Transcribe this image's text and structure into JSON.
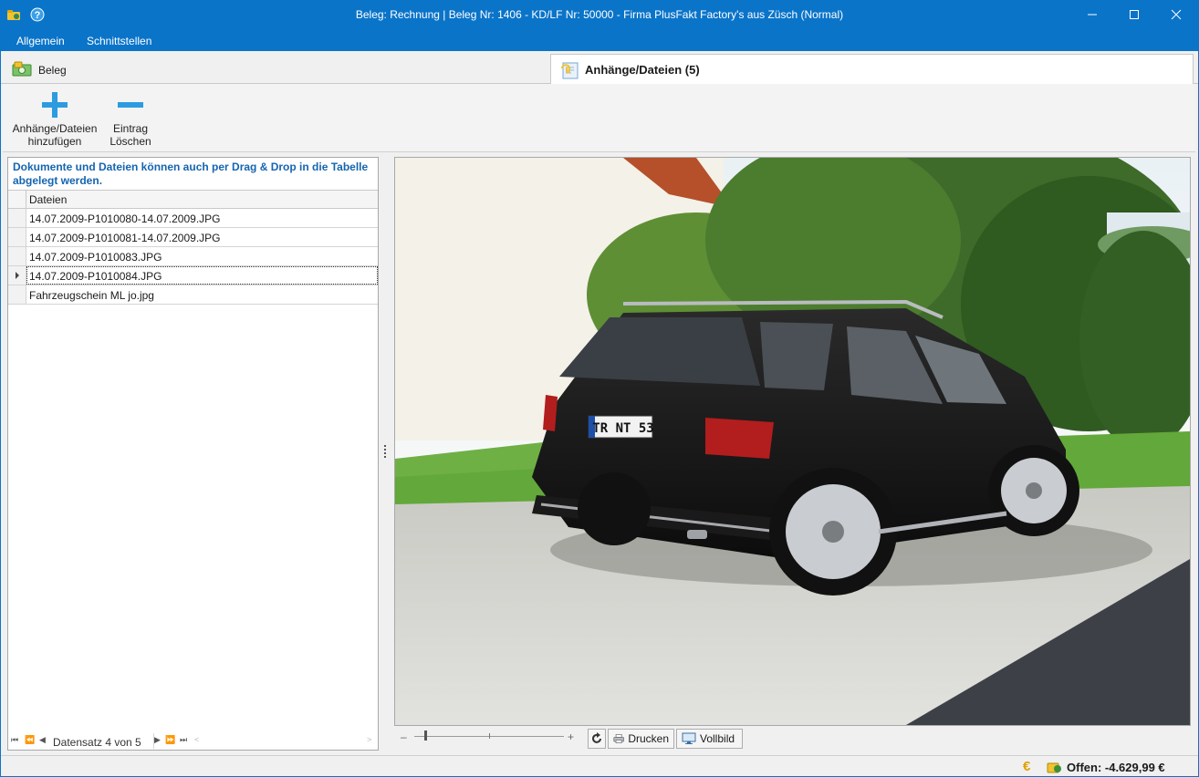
{
  "window": {
    "title": "Beleg: Rechnung | Beleg Nr: 1406 -  KD/LF Nr: 50000 - Firma PlusFakt Factory's  aus Züsch (Normal)",
    "app_icon": "coins-folder-icon",
    "help_icon": "help-icon"
  },
  "menu": {
    "items": [
      "Allgemein",
      "Schnittstellen"
    ]
  },
  "tabs": [
    {
      "label": "Beleg",
      "icon": "money-icon",
      "active": false
    },
    {
      "label": "Anhänge/Dateien (5)",
      "icon": "attachment-icon",
      "active": true
    }
  ],
  "toolbar": {
    "add_label": "Anhänge/Dateien\nhinzufügen",
    "delete_label": "Eintrag\nLöschen"
  },
  "files": {
    "hint": "Dokumente und Dateien können auch per Drag & Drop in die Tabelle abgelegt werden.",
    "column": "Dateien",
    "rows": [
      "14.07.2009-P1010080-14.07.2009.JPG",
      "14.07.2009-P1010081-14.07.2009.JPG",
      "14.07.2009-P1010083.JPG",
      "14.07.2009-P1010084.JPG",
      "Fahrzeugschein ML jo.jpg"
    ],
    "selected_index": 3,
    "navigator": "Datensatz 4 von 5"
  },
  "viewer": {
    "plate_text": "TR NT 53",
    "print_label": "Drucken",
    "fullscreen_label": "Vollbild",
    "zoom_minus": "–",
    "zoom_plus": "+"
  },
  "status": {
    "euro_symbol": "€",
    "open_amount": "Offen: -4.629,99 €"
  },
  "colors": {
    "titlebar": "#0a74c9",
    "hint_text": "#1565b0",
    "add_icon": "#2d9be0"
  }
}
